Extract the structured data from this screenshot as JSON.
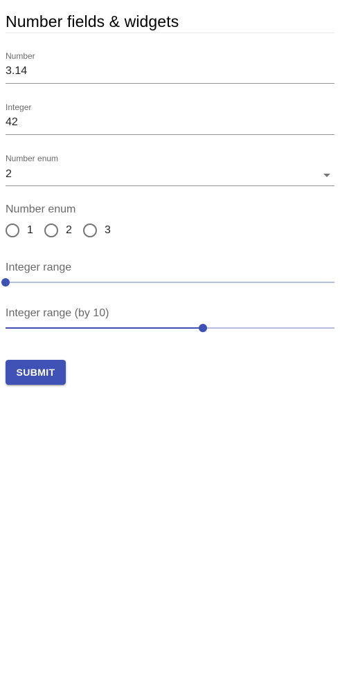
{
  "form": {
    "title": "Number fields & widgets",
    "number": {
      "label": "Number",
      "value": "3.14"
    },
    "integer": {
      "label": "Integer",
      "value": "42"
    },
    "number_enum_select": {
      "label": "Number enum",
      "selected": "2",
      "icon": "dropdown-arrow-icon"
    },
    "number_enum_radio": {
      "label": "Number enum",
      "options": [
        {
          "label": "1"
        },
        {
          "label": "2"
        },
        {
          "label": "3"
        }
      ],
      "selected_index": null
    },
    "integer_range": {
      "label": "Integer range",
      "fill_fraction": 0.0
    },
    "integer_range_by_10": {
      "label": "Integer range (by 10)",
      "fill_fraction": 0.6
    },
    "submit_label": "SUBMIT"
  },
  "colors": {
    "primary": "#3f51b5",
    "text": "#000000",
    "muted_text": "#757575",
    "underline": "#949494"
  }
}
